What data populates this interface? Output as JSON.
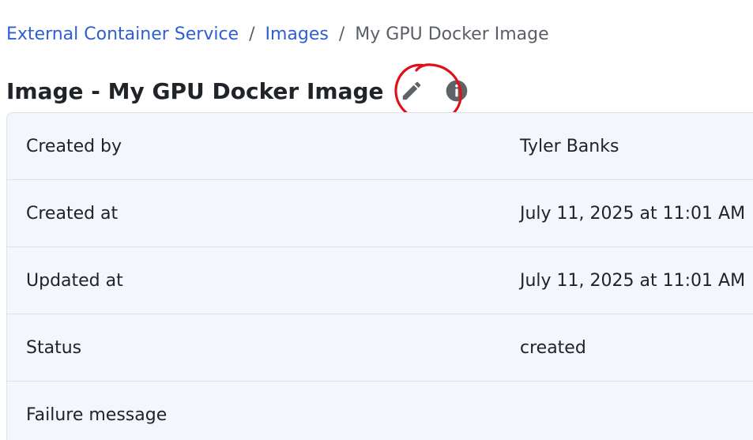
{
  "breadcrumb": {
    "items": [
      {
        "label": "External Container Service"
      },
      {
        "label": "Images"
      },
      {
        "label": "My GPU Docker Image"
      }
    ],
    "separator": "/"
  },
  "header": {
    "title": "Image - My GPU Docker Image",
    "edit_icon": "pencil-icon",
    "info_icon": "info-icon"
  },
  "details": {
    "rows": [
      {
        "label": "Created by",
        "value": "Tyler Banks"
      },
      {
        "label": "Created at",
        "value": "July 11, 2025 at 11:01 AM"
      },
      {
        "label": "Updated at",
        "value": "July 11, 2025 at 11:01 AM"
      },
      {
        "label": "Status",
        "value": "created"
      },
      {
        "label": "Failure message",
        "value": ""
      }
    ]
  },
  "colors": {
    "link": "#2d5fd1",
    "annotation": "#e0101b",
    "card_background": "#f3f6fa",
    "icon": "#5f6368"
  }
}
